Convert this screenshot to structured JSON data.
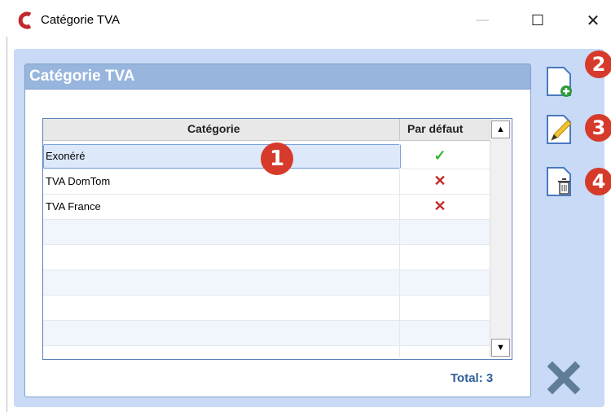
{
  "window": {
    "title": "Catégorie TVA",
    "minimize_glyph": "—",
    "maximize_glyph": "☐",
    "close_glyph": "✕"
  },
  "panel": {
    "title": "Catégorie TVA"
  },
  "table": {
    "columns": [
      "Catégorie",
      "Par défaut"
    ],
    "rows": [
      {
        "categorie": "Exonéré",
        "par_defaut": true,
        "mark": "✓"
      },
      {
        "categorie": "TVA DomTom",
        "par_defaut": false,
        "mark": "✕"
      },
      {
        "categorie": "TVA France",
        "par_defaut": false,
        "mark": "✕"
      }
    ],
    "empty_rows": 6,
    "scroll_up_glyph": "▲",
    "scroll_down_glyph": "▼"
  },
  "total": "Total: 3",
  "callouts": [
    "1",
    "2",
    "3",
    "4"
  ],
  "icons": {
    "app": "app-logo-icon",
    "add": "document-add-icon",
    "edit": "document-edit-icon",
    "delete": "document-delete-icon",
    "cancel": "cancel-x-icon"
  },
  "colors": {
    "accent_red": "#d63a2a",
    "panel_header": "#97b5dd",
    "client_bg": "#c8daf5",
    "check": "#2eb82e",
    "cross": "#c42a2a"
  }
}
